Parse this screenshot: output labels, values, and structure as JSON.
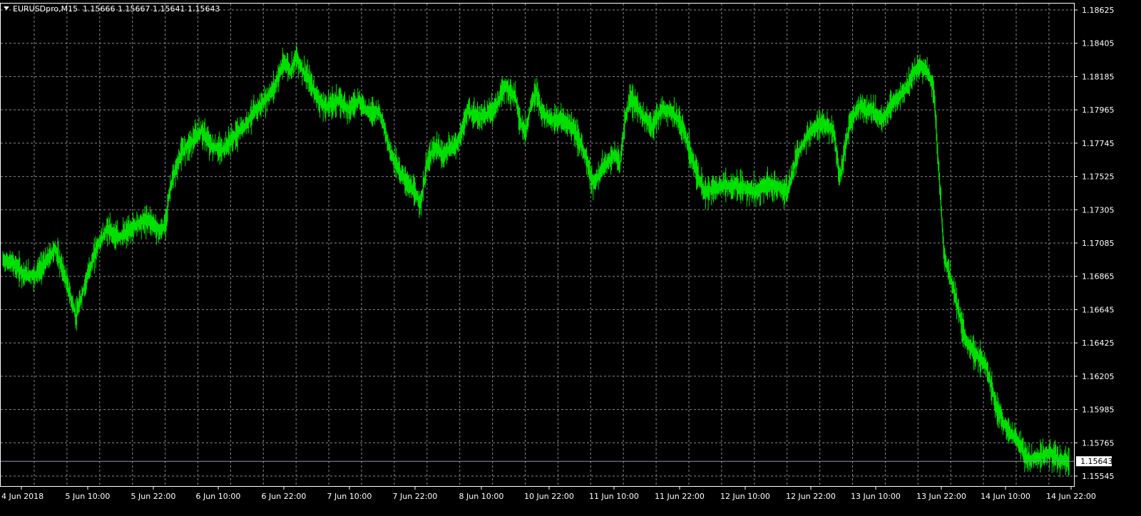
{
  "header": {
    "symbol": "EURUSDpro,M15",
    "ohlc": "1.15666 1.15667 1.15641 1.15643",
    "dropdown_icon": "triangle-down-icon"
  },
  "colors": {
    "background": "#000000",
    "grid": "#8a8a8a",
    "candles": "#00e000",
    "axis": "#ffffff",
    "price_line": "#8a9aa8",
    "price_tag_bg": "#ffffff"
  },
  "current_price_label": "1.15643",
  "chart_data": {
    "type": "line",
    "title": "",
    "timeframe": "M15",
    "grid": true,
    "ylim": [
      1.155,
      1.187
    ],
    "y_ticks": [
      "1.18625",
      "1.18405",
      "1.18185",
      "1.17965",
      "1.17745",
      "1.17525",
      "1.17305",
      "1.17085",
      "1.16865",
      "1.16645",
      "1.16425",
      "1.16205",
      "1.15985",
      "1.15765",
      "1.15545"
    ],
    "x_ticks": [
      "4 Jun 2018",
      "5 Jun 10:00",
      "5 Jun 22:00",
      "6 Jun 10:00",
      "6 Jun 22:00",
      "7 Jun 10:00",
      "7 Jun 22:00",
      "8 Jun 10:00",
      "10 Jun 22:00",
      "11 Jun 10:00",
      "11 Jun 22:00",
      "12 Jun 10:00",
      "12 Jun 22:00",
      "13 Jun 10:00",
      "13 Jun 22:00",
      "14 Jun 10:00",
      "14 Jun 22:00"
    ],
    "current_price": 1.15643,
    "series": [
      {
        "x_index": [
          0,
          4,
          8,
          12,
          16,
          20,
          24,
          26,
          28,
          32,
          36,
          40,
          44,
          48,
          52,
          56,
          60,
          62,
          64,
          68,
          70,
          72,
          76,
          80,
          84,
          88,
          92,
          96,
          100,
          104,
          106,
          108,
          110,
          112,
          114,
          118,
          120,
          122,
          124,
          128,
          130,
          132,
          136,
          140,
          144,
          148,
          152,
          156,
          160,
          162,
          164,
          166,
          168,
          170,
          174,
          176,
          178,
          180,
          184,
          188,
          192,
          196,
          198,
          200,
          202,
          204,
          206,
          210,
          214,
          218,
          222,
          226,
          230,
          234,
          236,
          238,
          240,
          244,
          248,
          252,
          256,
          260,
          264,
          268,
          272,
          274,
          276,
          278,
          280,
          284,
          288,
          292,
          296,
          300,
          304,
          308,
          312,
          316,
          318,
          320,
          324,
          328,
          330,
          332,
          336,
          340,
          344,
          346,
          348,
          350,
          352,
          354,
          356,
          358,
          360,
          364,
          368,
          372,
          376,
          380,
          384,
          388,
          392,
          396,
          400,
          404,
          408
        ],
        "values": [
          1.1697,
          1.1695,
          1.1688,
          1.1687,
          1.1695,
          1.1705,
          1.1685,
          1.1672,
          1.166,
          1.1685,
          1.1706,
          1.1718,
          1.1712,
          1.1716,
          1.1722,
          1.1724,
          1.1716,
          1.172,
          1.1745,
          1.1767,
          1.1772,
          1.1775,
          1.1783,
          1.1772,
          1.177,
          1.1778,
          1.1785,
          1.1795,
          1.1802,
          1.1812,
          1.1822,
          1.1828,
          1.1822,
          1.1832,
          1.1825,
          1.1813,
          1.1806,
          1.18,
          1.1799,
          1.1803,
          1.1801,
          1.1797,
          1.1803,
          1.1795,
          1.1796,
          1.177,
          1.1755,
          1.1745,
          1.1735,
          1.176,
          1.1768,
          1.1772,
          1.1766,
          1.177,
          1.1775,
          1.1785,
          1.1797,
          1.1792,
          1.1792,
          1.1797,
          1.1812,
          1.1805,
          1.1788,
          1.1782,
          1.18,
          1.1808,
          1.1795,
          1.179,
          1.179,
          1.1785,
          1.177,
          1.1747,
          1.176,
          1.1767,
          1.176,
          1.179,
          1.1804,
          1.1795,
          1.1785,
          1.1797,
          1.1795,
          1.1785,
          1.1763,
          1.1742,
          1.1745,
          1.1745,
          1.1748,
          1.1745,
          1.1747,
          1.1745,
          1.1743,
          1.1747,
          1.1746,
          1.1742,
          1.1768,
          1.178,
          1.1788,
          1.1785,
          1.178,
          1.175,
          1.1788,
          1.18,
          1.1796,
          1.1797,
          1.179,
          1.18,
          1.1808,
          1.1812,
          1.182,
          1.1825,
          1.1825,
          1.182,
          1.181,
          1.1755,
          1.17,
          1.1675,
          1.1645,
          1.1635,
          1.1628,
          1.16,
          1.1585,
          1.1578,
          1.1565,
          1.1567,
          1.157,
          1.1565,
          1.15643
        ]
      }
    ]
  }
}
